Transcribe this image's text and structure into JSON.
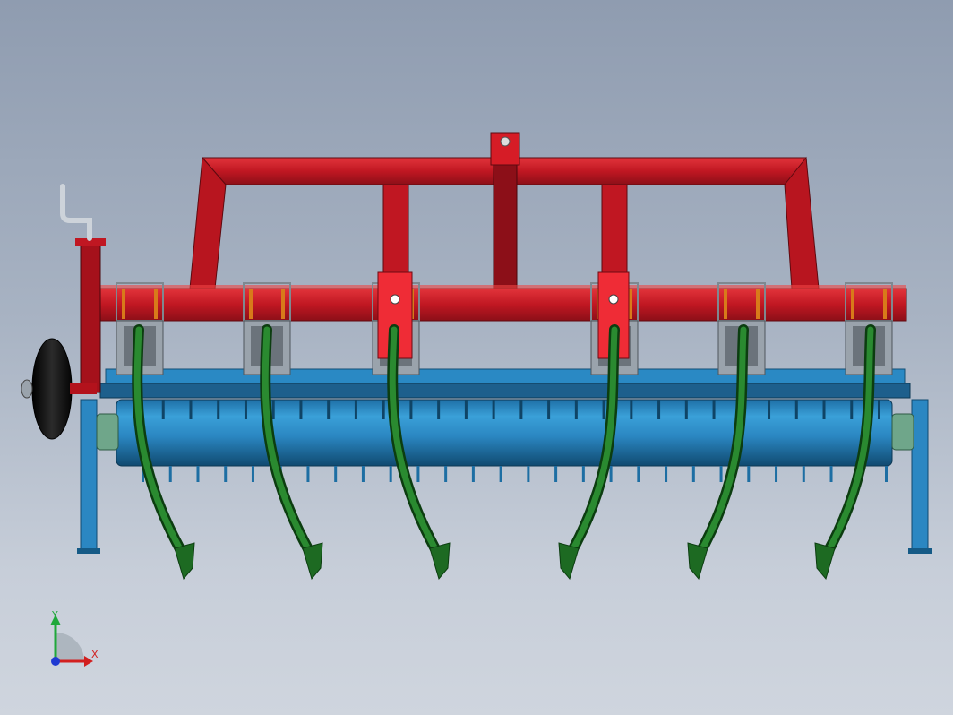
{
  "triad": {
    "y_label": "Y",
    "x_label": "X"
  },
  "colors": {
    "frame_red": "#c01722",
    "frame_red_dark": "#7e0f16",
    "frame_red_light": "#e83a3a",
    "roller_blue": "#2b87c2",
    "roller_blue_dark": "#155a86",
    "tine_green": "#1d6a22",
    "tine_green_dark": "#0c3d10",
    "wheel_black": "#141414",
    "bracket_gray": "#9aa3ac",
    "bolt_orange": "#d87a1a",
    "axis_x": "#d21f1f",
    "axis_y": "#1fa83a",
    "axis_z": "#1f3ad2"
  },
  "parts": {
    "tine_count": 6,
    "roller_teeth_count": 28,
    "spring_bracket_count": 6,
    "hitch_posts": 2
  }
}
